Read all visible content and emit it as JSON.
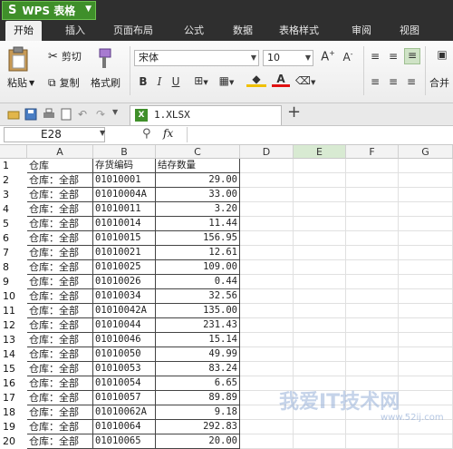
{
  "app": {
    "logo": "S",
    "name": "WPS 表格"
  },
  "tabs": [
    "开始",
    "插入",
    "页面布局",
    "公式",
    "数据",
    "表格样式",
    "审阅",
    "视图"
  ],
  "ribbon": {
    "paste": "粘贴",
    "cut": "剪切",
    "copy": "复制",
    "format_painter": "格式刷",
    "font_name": "宋体",
    "font_size": "10",
    "bold": "B",
    "italic": "I",
    "underline": "U",
    "merge_center": "合并"
  },
  "quickbar": {
    "file_tab": "1.XLSX",
    "add_tab": "+"
  },
  "formula_bar": {
    "name_box": "E28",
    "fx": "fx"
  },
  "columns": [
    "A",
    "B",
    "C",
    "D",
    "E",
    "F",
    "G"
  ],
  "selected_column": "E",
  "rows": [
    {
      "n": "1",
      "a": "仓库",
      "b": "存货编码",
      "c": ""
    },
    {
      "n": "2",
      "a": "仓库：全部",
      "b": "01010001",
      "c": "29.00"
    },
    {
      "n": "3",
      "a": "仓库：全部",
      "b": "01010004A",
      "c": "33.00"
    },
    {
      "n": "4",
      "a": "仓库：全部",
      "b": "01010011",
      "c": "3.20"
    },
    {
      "n": "5",
      "a": "仓库：全部",
      "b": "01010014",
      "c": "11.44"
    },
    {
      "n": "6",
      "a": "仓库：全部",
      "b": "01010015",
      "c": "156.95"
    },
    {
      "n": "7",
      "a": "仓库：全部",
      "b": "01010021",
      "c": "12.61"
    },
    {
      "n": "8",
      "a": "仓库：全部",
      "b": "01010025",
      "c": "109.00"
    },
    {
      "n": "9",
      "a": "仓库：全部",
      "b": "01010026",
      "c": "0.44"
    },
    {
      "n": "10",
      "a": "仓库：全部",
      "b": "01010034",
      "c": "32.56"
    },
    {
      "n": "11",
      "a": "仓库：全部",
      "b": "01010042A",
      "c": "135.00"
    },
    {
      "n": "12",
      "a": "仓库：全部",
      "b": "01010044",
      "c": "231.43"
    },
    {
      "n": "13",
      "a": "仓库：全部",
      "b": "01010046",
      "c": "15.14"
    },
    {
      "n": "14",
      "a": "仓库：全部",
      "b": "01010050",
      "c": "49.99"
    },
    {
      "n": "15",
      "a": "仓库：全部",
      "b": "01010053",
      "c": "83.24"
    },
    {
      "n": "16",
      "a": "仓库：全部",
      "b": "01010054",
      "c": "6.65"
    },
    {
      "n": "17",
      "a": "仓库：全部",
      "b": "01010057",
      "c": "89.89"
    },
    {
      "n": "18",
      "a": "仓库：全部",
      "b": "01010062A",
      "c": "9.18"
    },
    {
      "n": "19",
      "a": "仓库：全部",
      "b": "01010064",
      "c": "292.83"
    },
    {
      "n": "20",
      "a": "仓库：全部",
      "b": "01010065",
      "c": "20.00"
    }
  ],
  "header_c1": "结存数量",
  "watermark": {
    "main": "我爱IT技术网",
    "url": "www.52ij.com"
  },
  "colors": {
    "accent": "#3f8f2a",
    "dark": "#2f2f2f",
    "selected_col": "#d8ead2"
  }
}
